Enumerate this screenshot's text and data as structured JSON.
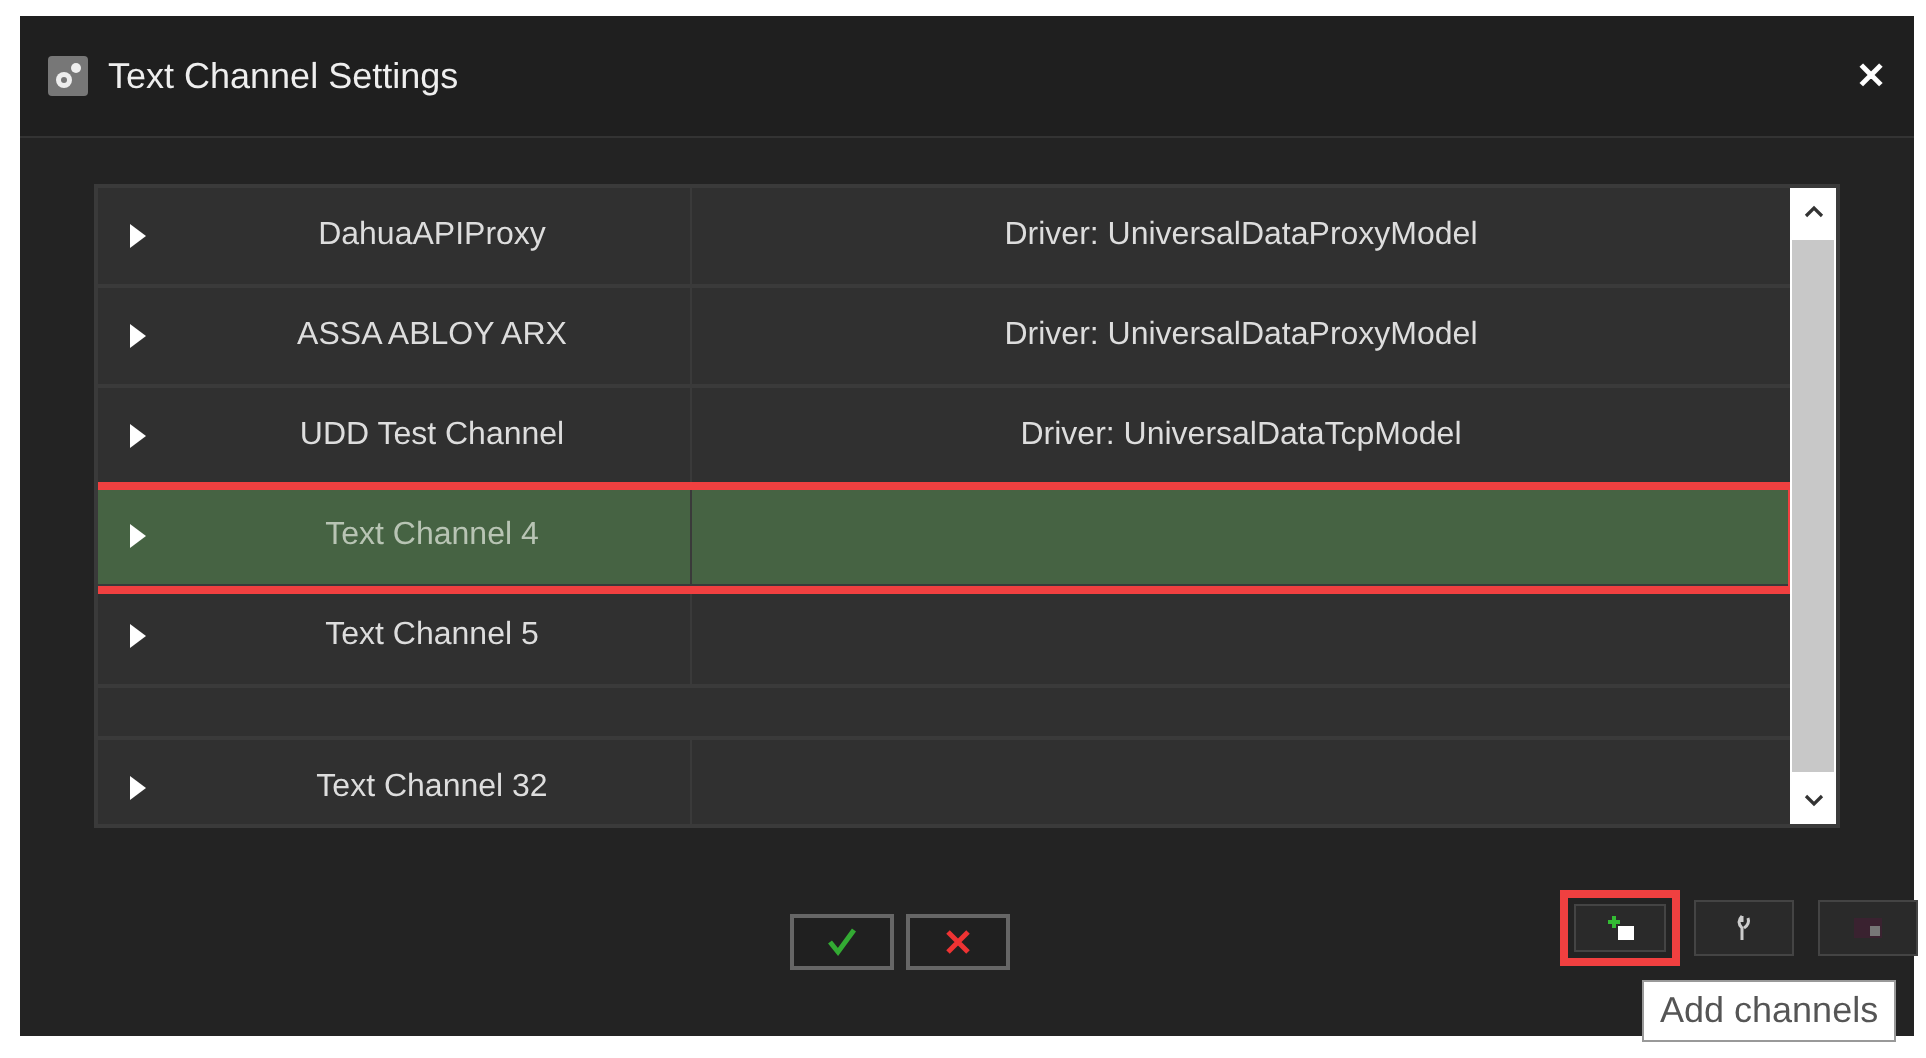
{
  "window": {
    "title": "Text Channel Settings",
    "close": "✕"
  },
  "channels": [
    {
      "kind": "row",
      "name": "DahuaAPIProxy",
      "driver": "Driver: UniversalDataProxyModel",
      "selected": false,
      "highlighted": false
    },
    {
      "kind": "row",
      "name": "ASSA ABLOY ARX",
      "driver": "Driver: UniversalDataProxyModel",
      "selected": false,
      "highlighted": false
    },
    {
      "kind": "row",
      "name": "UDD Test Channel",
      "driver": "Driver: UniversalDataTcpModel",
      "selected": false,
      "highlighted": false
    },
    {
      "kind": "row",
      "name": "Text Channel 4",
      "selected": true,
      "highlighted": true
    },
    {
      "kind": "row",
      "name": "Text Channel 5",
      "selected": false,
      "highlighted": false
    },
    {
      "kind": "clipped"
    },
    {
      "kind": "row",
      "name": "Text Channel 32",
      "selected": false,
      "highlighted": false
    }
  ],
  "tools": [
    {
      "kind": "add",
      "highlighted": true,
      "tooltip": "Add channels"
    },
    {
      "kind": "wrench",
      "highlighted": false
    },
    {
      "kind": "dim",
      "highlighted": false
    }
  ]
}
